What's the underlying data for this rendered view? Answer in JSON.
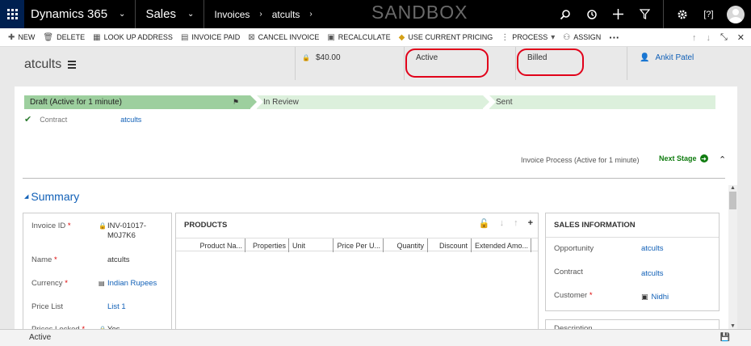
{
  "app": {
    "name": "Dynamics 365",
    "area": "Sales",
    "breadcrumb": [
      "Invoices",
      "atcults"
    ],
    "environment": "SANDBOX"
  },
  "commands": [
    {
      "icon": "plus-icon",
      "label": "NEW"
    },
    {
      "icon": "trash-icon",
      "label": "DELETE"
    },
    {
      "icon": "address-icon",
      "label": "LOOK UP ADDRESS"
    },
    {
      "icon": "document-icon",
      "label": "INVOICE PAID"
    },
    {
      "icon": "cancel-doc-icon",
      "label": "CANCEL INVOICE"
    },
    {
      "icon": "calculator-icon",
      "label": "RECALCULATE"
    },
    {
      "icon": "tag-icon",
      "label": "USE CURRENT PRICING"
    },
    {
      "icon": "process-icon",
      "label": "PROCESS"
    },
    {
      "icon": "assign-icon",
      "label": "ASSIGN"
    }
  ],
  "header": {
    "title": "atcults",
    "amount": "$40.00",
    "status": "Active",
    "status_reason": "Billed",
    "owner": "Ankit Patel"
  },
  "process": {
    "stages": [
      {
        "label": "Draft (Active for 1 minute)",
        "state": "active"
      },
      {
        "label": "In Review",
        "state": "pending"
      },
      {
        "label": "Sent",
        "state": "pending"
      }
    ],
    "steps": [
      {
        "label": "Contract",
        "value": "atcults"
      }
    ],
    "status": "Invoice Process (Active for 1 minute)",
    "next_label": "Next Stage"
  },
  "summary": {
    "title": "Summary",
    "fields": [
      {
        "label": "Invoice ID",
        "required": true,
        "locked": true,
        "value_line1": "INV-01017-",
        "value_line2": "M0J7K6"
      },
      {
        "label": "Name",
        "required": true,
        "value": "atcults"
      },
      {
        "label": "Currency",
        "required": true,
        "value": "Indian Rupees"
      },
      {
        "label": "Price List",
        "required": false,
        "value": "List 1"
      },
      {
        "label": "Prices Locked",
        "required": true,
        "locked": true,
        "value": "Yes"
      }
    ]
  },
  "products": {
    "title": "PRODUCTS",
    "columns": [
      "Product Na...",
      "Properties",
      "Unit",
      "Price Per U...",
      "Quantity",
      "Discount",
      "Extended Amo..."
    ]
  },
  "sales_info": {
    "title": "SALES INFORMATION",
    "fields": [
      {
        "label": "Opportunity",
        "value": "atcults"
      },
      {
        "label": "Contract",
        "value": "atcults"
      },
      {
        "label": "Customer",
        "value": "Nidhi",
        "required": true
      }
    ],
    "description_label": "Description"
  },
  "footer": {
    "status": "Active"
  },
  "colors": {
    "nav": "#000000",
    "active_stage": "#9dcf9e",
    "pending_stage": "#dcf0dc",
    "link": "#1160b7",
    "highlight_circle": "#e1001a"
  }
}
